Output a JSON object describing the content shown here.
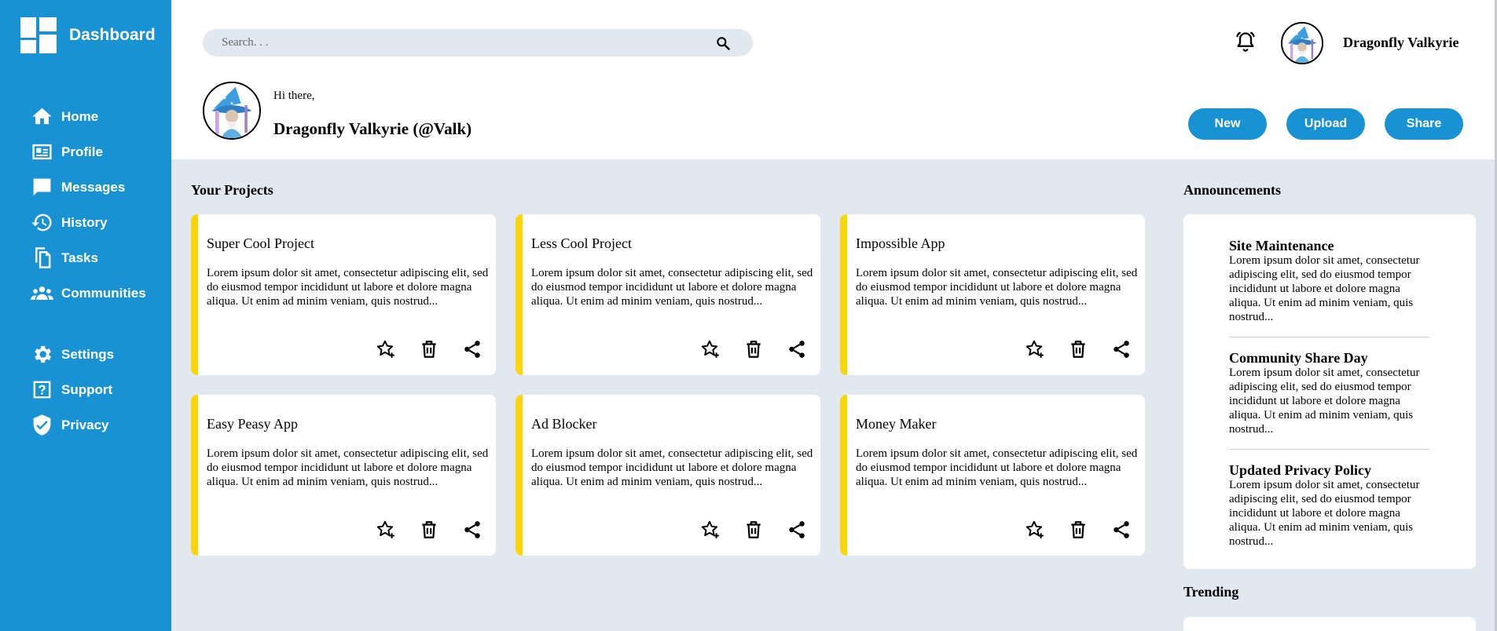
{
  "app": {
    "title": "Dashboard"
  },
  "sidebar": {
    "main_items": [
      {
        "label": "Home",
        "icon": "home-icon"
      },
      {
        "label": "Profile",
        "icon": "id-card-icon"
      },
      {
        "label": "Messages",
        "icon": "chat-icon"
      },
      {
        "label": "History",
        "icon": "history-icon"
      },
      {
        "label": "Tasks",
        "icon": "document-icon"
      },
      {
        "label": "Communities",
        "icon": "people-icon"
      }
    ],
    "secondary_items": [
      {
        "label": "Settings",
        "icon": "gear-icon"
      },
      {
        "label": "Support",
        "icon": "help-icon"
      },
      {
        "label": "Privacy",
        "icon": "shield-icon"
      }
    ]
  },
  "header": {
    "search_placeholder": "Search. . .",
    "username": "Dragonfly Valkyrie",
    "greeting": "Hi there,",
    "display_name": "Dragonfly Valkyrie (@Valk)",
    "actions": [
      "New",
      "Upload",
      "Share"
    ]
  },
  "projects": {
    "title": "Your Projects",
    "items": [
      {
        "title": "Super Cool Project",
        "description": "Lorem ipsum dolor sit amet, consectetur adipiscing elit, sed do eiusmod tempor incididunt ut labore et dolore magna aliqua. Ut enim ad minim veniam, quis nostrud..."
      },
      {
        "title": "Less Cool Project",
        "description": "Lorem ipsum dolor sit amet, consectetur adipiscing elit, sed do eiusmod tempor incididunt ut labore et dolore magna aliqua. Ut enim ad minim veniam, quis nostrud..."
      },
      {
        "title": "Impossible App",
        "description": "Lorem ipsum dolor sit amet, consectetur adipiscing elit, sed do eiusmod tempor incididunt ut labore et dolore magna aliqua. Ut enim ad minim veniam, quis nostrud..."
      },
      {
        "title": "Easy Peasy App",
        "description": "Lorem ipsum dolor sit amet, consectetur adipiscing elit, sed do eiusmod tempor incididunt ut labore et dolore magna aliqua. Ut enim ad minim veniam, quis nostrud..."
      },
      {
        "title": "Ad Blocker",
        "description": "Lorem ipsum dolor sit amet, consectetur adipiscing elit, sed do eiusmod tempor incididunt ut labore et dolore magna aliqua. Ut enim ad minim veniam, quis nostrud..."
      },
      {
        "title": "Money Maker",
        "description": "Lorem ipsum dolor sit amet, consectetur adipiscing elit, sed do eiusmod tempor incididunt ut labore et dolore magna aliqua. Ut enim ad minim veniam, quis nostrud..."
      }
    ]
  },
  "announcements": {
    "title": "Announcements",
    "items": [
      {
        "title": "Site Maintenance",
        "body": "Lorem ipsum dolor sit amet, consectetur adipiscing elit, sed do eiusmod tempor incididunt ut labore et dolore magna aliqua. Ut enim ad minim veniam, quis nostrud..."
      },
      {
        "title": "Community Share Day",
        "body": "Lorem ipsum dolor sit amet, consectetur adipiscing elit, sed do eiusmod tempor incididunt ut labore et dolore magna aliqua. Ut enim ad minim veniam, quis nostrud..."
      },
      {
        "title": "Updated Privacy Policy",
        "body": "Lorem ipsum dolor sit amet, consectetur adipiscing elit, sed do eiusmod tempor incididunt ut labore et dolore magna aliqua. Ut enim ad minim veniam, quis nostrud..."
      }
    ]
  },
  "trending": {
    "title": "Trending"
  },
  "colors": {
    "sidebar": "#1992d4",
    "accent": "#1992d4",
    "card_stripe": "#fbd50a",
    "background": "#e2e8f0"
  }
}
